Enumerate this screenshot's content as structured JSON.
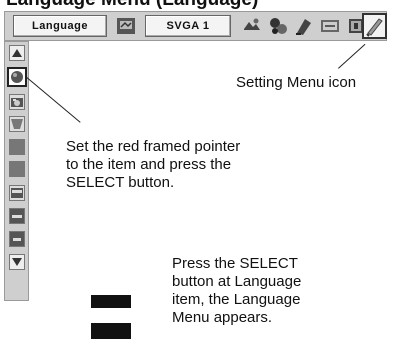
{
  "header_cut": "Language Menu (Language)",
  "menubar": {
    "language_label": "Language",
    "mode_label": "SVGA 1"
  },
  "icons": {
    "top": [
      "computer-adjust-icon",
      "image-select-icon",
      "image-adjust-icon",
      "screen-icon",
      "setting-icon",
      "information-icon",
      "setting-menu-icon"
    ],
    "side": [
      "scroll-up-icon",
      "language-item-icon",
      "camera-item-icon",
      "keystone-item-icon",
      "item-blank-icon",
      "item-blank-icon",
      "screen-item-icon",
      "pin-code-item-icon",
      "remote-item-icon",
      "scroll-down-icon"
    ]
  },
  "callouts": {
    "setting_menu_icon": "Setting Menu icon",
    "pointer_instruction": [
      "Set the red framed pointer",
      "to the item and press the",
      "SELECT button."
    ],
    "select_instruction": [
      "Press the SELECT",
      "button at Language",
      "item, the Language",
      "Menu appears."
    ]
  }
}
